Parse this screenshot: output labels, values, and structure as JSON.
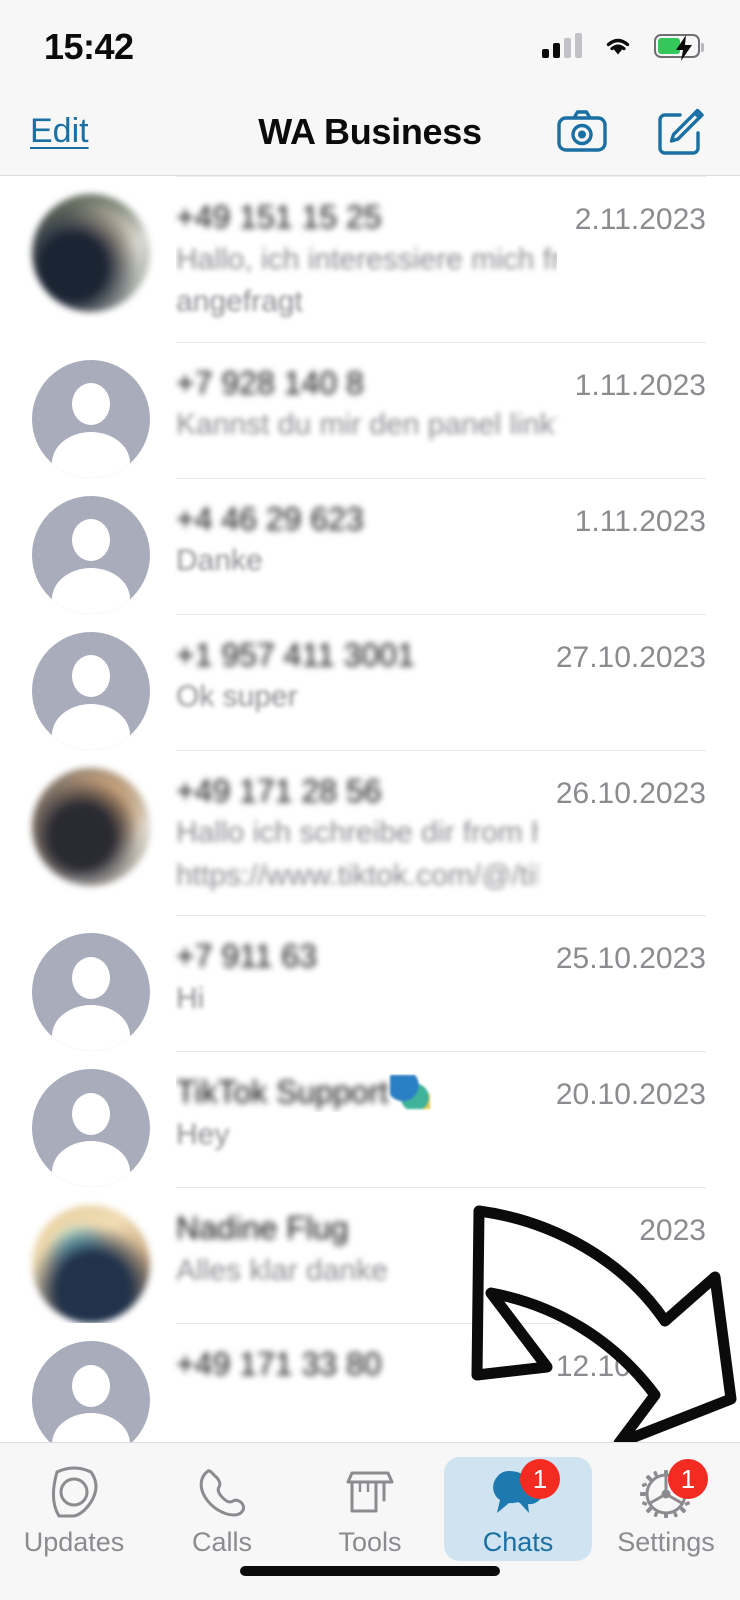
{
  "status_bar": {
    "time": "15:42",
    "signal_icon": "cellular-signal-icon",
    "wifi_icon": "wifi-icon",
    "battery_icon": "battery-charging-icon"
  },
  "nav_bar": {
    "edit_label": "Edit",
    "title": "WA Business",
    "camera_icon": "camera-icon",
    "compose_icon": "compose-new-chat-icon"
  },
  "colors": {
    "accent_blue": "#1a6fa3",
    "tab_active_pill": "#cfe3f1",
    "badge_red": "#f42b20",
    "bar_background": "#f7f7f8",
    "secondary_text": "#8b8b90",
    "battery_green": "#34c759"
  },
  "chats": [
    {
      "avatar": "photo",
      "name": "+49 151 15 25",
      "message": "Hallo, ich interessiere mich from",
      "message_tail": "from",
      "message2": "angefragt",
      "date": "2.11.2023"
    },
    {
      "avatar": "default",
      "name": "+7 928 140 8",
      "message": "Kannst du mir den panel link?",
      "message_tail": "panel link?",
      "message2": "",
      "date": "1.11.2023"
    },
    {
      "avatar": "default",
      "name": "+4 46 29 623",
      "message": "Danke",
      "message_tail": "",
      "message2": "",
      "date": "1.11.2023"
    },
    {
      "avatar": "default",
      "name": "+1 957 411 3001",
      "message": "Ok super",
      "message_tail": "",
      "message2": "",
      "date": "27.10.2023"
    },
    {
      "avatar": "photo",
      "name": "+49 171 28 56",
      "message": "Hallo ich schreibe dir from here",
      "message_tail": "here",
      "message2": "https://www.tiktok.com/@/tiktok/",
      "message2_tail": "/tiktok/",
      "date": "26.10.2023"
    },
    {
      "avatar": "default",
      "name": "+7 911 63",
      "message": "Hi",
      "message_tail": "",
      "message2": "",
      "date": "25.10.2023"
    },
    {
      "avatar": "default",
      "name": "TikTok Support",
      "name_emoji": "blue-green-emoji",
      "message": "Hey",
      "message_tail": "",
      "message2": "",
      "date": "20.10.2023"
    },
    {
      "avatar": "photo",
      "name": "Nadine Flug",
      "message": "Alles klar danke",
      "message_tail": "",
      "message2": "",
      "date": "2023"
    },
    {
      "avatar": "default",
      "name": "+49 171 33 80",
      "message": "",
      "message_tail": "",
      "message2": "",
      "date": "12.10.2023"
    }
  ],
  "overlay": {
    "arrow_icon": "curved-arrow-pointing-down-right"
  },
  "tab_bar": {
    "items": [
      {
        "label": "Updates",
        "icon": "status-updates-icon",
        "active": false,
        "badge": ""
      },
      {
        "label": "Calls",
        "icon": "phone-icon",
        "active": false,
        "badge": ""
      },
      {
        "label": "Tools",
        "icon": "storefront-tools-icon",
        "active": false,
        "badge": ""
      },
      {
        "label": "Chats",
        "icon": "chat-bubbles-icon",
        "active": true,
        "badge": "1"
      },
      {
        "label": "Settings",
        "icon": "gear-icon",
        "active": false,
        "badge": "1"
      }
    ]
  }
}
